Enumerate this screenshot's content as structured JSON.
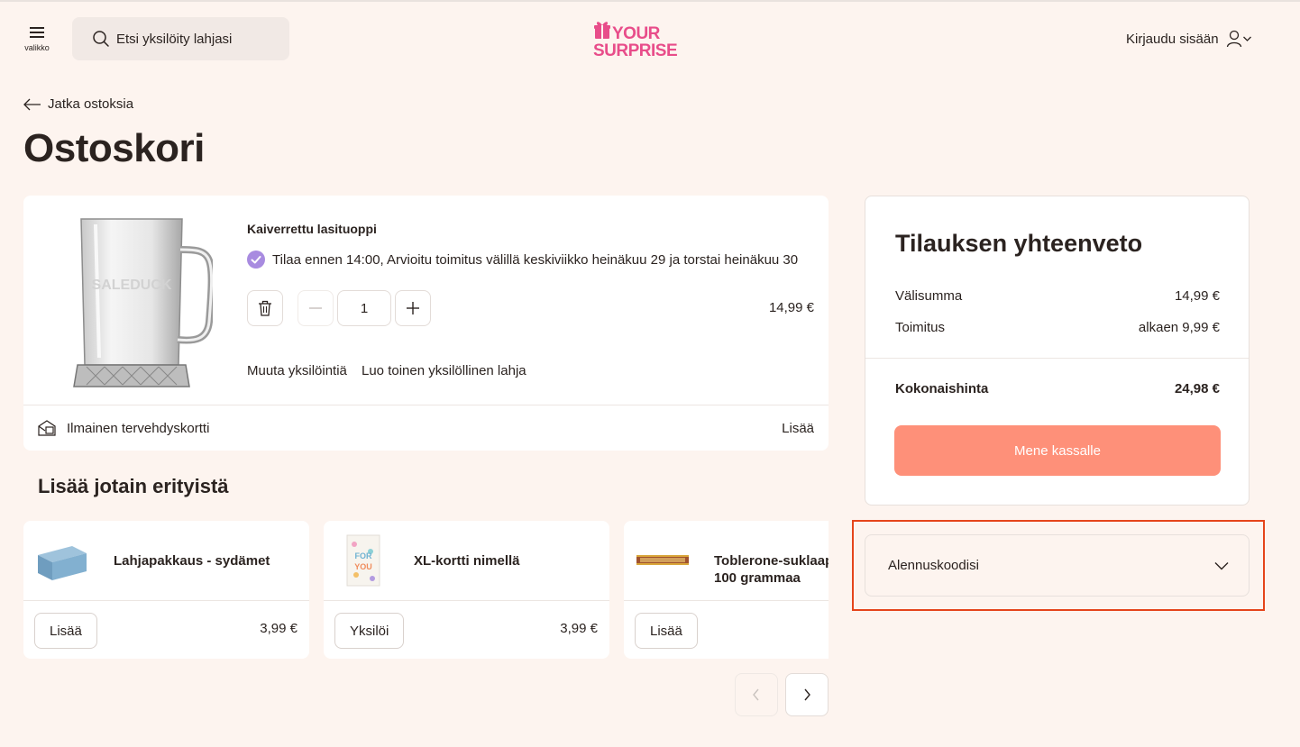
{
  "header": {
    "menu_label": "valikko",
    "search_placeholder": "Etsi yksilöity lahjasi",
    "logo_line1": "YOUR",
    "logo_line2": "SURPRISE",
    "login_label": "Kirjaudu sisään"
  },
  "nav": {
    "back_label": "Jatka ostoksia"
  },
  "page_title": "Ostoskori",
  "cart": {
    "item": {
      "name": "Kaiverrettu lasituoppi",
      "engraving_text": "SALEDUCK",
      "delivery_text": "Tilaa ennen 14:00, Arvioitu toimitus välillä keskiviikko heinäkuu 29 ja torstai heinäkuu 30",
      "quantity": "1",
      "price": "14,99 €",
      "edit_label": "Muuta yksilöintiä",
      "new_label": "Luo toinen yksilöllinen lahja"
    },
    "greeting_card": {
      "label": "Ilmainen tervehdyskortti",
      "add_label": "Lisää"
    }
  },
  "upsell": {
    "title": "Lisää jotain erityistä",
    "items": [
      {
        "name": "Lahjapakkaus - sydämet",
        "button": "Lisää",
        "price": "3,99 €"
      },
      {
        "name": "XL-kortti nimellä",
        "button": "Yksilöi",
        "price": "3,99 €"
      },
      {
        "name_line1": "Toblerone-suklaap",
        "name_line2": "100 grammaa",
        "button": "Lisää",
        "price": ""
      }
    ]
  },
  "summary": {
    "title": "Tilauksen yhteenveto",
    "subtotal_label": "Välisumma",
    "subtotal_value": "14,99 €",
    "shipping_label": "Toimitus",
    "shipping_value": "alkaen 9,99 €",
    "total_label": "Kokonaishinta",
    "total_value": "24,98 €",
    "checkout_label": "Mene kassalle"
  },
  "discount": {
    "label": "Alennuskoodisi"
  },
  "colors": {
    "background": "#fdf4ef",
    "checkout": "#fe9079",
    "brand_pink": "#e84d8a",
    "check_purple": "#a88be0",
    "highlight": "#e5451b"
  }
}
